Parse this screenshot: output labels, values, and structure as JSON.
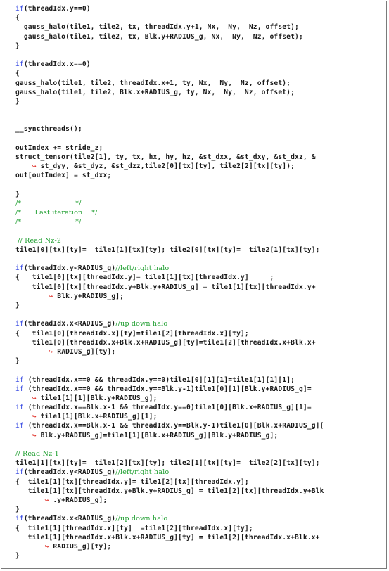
{
  "listing": {
    "lines": [
      [
        {
          "t": "kw",
          "v": "if"
        },
        {
          "t": "tx",
          "v": "(threadIdx.y==0)"
        }
      ],
      [
        {
          "t": "tx",
          "v": "{"
        }
      ],
      [
        {
          "t": "tx",
          "v": "  gauss_halo(tile1, tile2, tx, threadIdx.y+1, Nx,  Ny,  Nz, offset);"
        }
      ],
      [
        {
          "t": "tx",
          "v": "  gauss_halo(tile1, tile2, tx, Blk.y+RADIUS_g, Nx,  Ny,  Nz, offset);"
        }
      ],
      [
        {
          "t": "tx",
          "v": "}"
        }
      ],
      [],
      [
        {
          "t": "kw",
          "v": "if"
        },
        {
          "t": "tx",
          "v": "(threadIdx.x==0)"
        }
      ],
      [
        {
          "t": "tx",
          "v": "{"
        }
      ],
      [
        {
          "t": "tx",
          "v": "gauss_halo(tile1, tile2, threadIdx.x+1, ty, Nx,  Ny,  Nz, offset);"
        }
      ],
      [
        {
          "t": "tx",
          "v": "gauss_halo(tile1, tile2, Blk.x+RADIUS_g, ty, Nx,  Ny,  Nz, offset);"
        }
      ],
      [
        {
          "t": "tx",
          "v": "}"
        }
      ],
      [],
      [],
      [
        {
          "t": "tx",
          "v": "__syncthreads();"
        }
      ],
      [],
      [
        {
          "t": "tx",
          "v": "outIndex += stride_z;"
        }
      ],
      [
        {
          "t": "tx",
          "v": "struct_tensor(tile2[1], ty, tx, hx, hy, hz, &st_dxx, &st_dxy, &st_dxz, &"
        }
      ],
      [
        {
          "t": "tx",
          "v": "    "
        },
        {
          "t": "arrow",
          "v": "↪"
        },
        {
          "t": "tx",
          "v": " st_dyy, &st_dyz, &st_dzz,tile2[0][tx][ty], tile2[2][tx][ty]);"
        }
      ],
      [
        {
          "t": "tx",
          "v": "out[outIndex] = st_dxx;"
        }
      ],
      [],
      [
        {
          "t": "tx",
          "v": "}"
        }
      ],
      [
        {
          "t": "cm",
          "v": "/*                        */"
        }
      ],
      [
        {
          "t": "cm",
          "v": "/*      Last iteration    */"
        }
      ],
      [
        {
          "t": "cm",
          "v": "/*                        */"
        }
      ],
      [],
      [
        {
          "t": "cm",
          "v": " // Read Nz-2"
        }
      ],
      [
        {
          "t": "tx",
          "v": "tile1[0][tx][ty]=  tile1[1][tx][ty]; tile2[0][tx][ty]=  tile2[1][tx][ty];"
        }
      ],
      [],
      [
        {
          "t": "kw",
          "v": "if"
        },
        {
          "t": "tx",
          "v": "(threadIdx.y<RADIUS_g)"
        },
        {
          "t": "cm",
          "v": "//left/right halo"
        }
      ],
      [
        {
          "t": "tx",
          "v": "{   tile1[0][tx][threadIdx.y]= tile1[1][tx][threadIdx.y]     ;"
        }
      ],
      [
        {
          "t": "tx",
          "v": "    tile1[0][tx][threadIdx.y+Blk.y+RADIUS_g] = tile1[1][tx][threadIdx.y+"
        }
      ],
      [
        {
          "t": "tx",
          "v": "        "
        },
        {
          "t": "arrow",
          "v": "↪"
        },
        {
          "t": "tx",
          "v": " Blk.y+RADIUS_g];"
        }
      ],
      [
        {
          "t": "tx",
          "v": "}"
        }
      ],
      [],
      [
        {
          "t": "kw",
          "v": "if"
        },
        {
          "t": "tx",
          "v": "(threadIdx.x<RADIUS_g)"
        },
        {
          "t": "cm",
          "v": "//up down halo"
        }
      ],
      [
        {
          "t": "tx",
          "v": "{   tile1[0][threadIdx.x][ty]=tile1[2][threadIdx.x][ty];"
        }
      ],
      [
        {
          "t": "tx",
          "v": "    tile1[0][threadIdx.x+Blk.x+RADIUS_g][ty]=tile1[2][threadIdx.x+Blk.x+"
        }
      ],
      [
        {
          "t": "tx",
          "v": "        "
        },
        {
          "t": "arrow",
          "v": "↪"
        },
        {
          "t": "tx",
          "v": " RADIUS_g][ty];"
        }
      ],
      [
        {
          "t": "tx",
          "v": "}"
        }
      ],
      [],
      [
        {
          "t": "kw",
          "v": "if"
        },
        {
          "t": "tx",
          "v": " (threadIdx.x==0 && threadIdx.y==0)tile1[0][1][1]=tile1[1][1][1];"
        }
      ],
      [
        {
          "t": "kw",
          "v": "if"
        },
        {
          "t": "tx",
          "v": " (threadIdx.x==0 && threadIdx.y==Blk.y-1)tile1[0][1][Blk.y+RADIUS_g]="
        }
      ],
      [
        {
          "t": "tx",
          "v": "    "
        },
        {
          "t": "arrow",
          "v": "↪"
        },
        {
          "t": "tx",
          "v": " tile1[1][1][Blk.y+RADIUS_g];"
        }
      ],
      [
        {
          "t": "kw",
          "v": "if"
        },
        {
          "t": "tx",
          "v": " (threadIdx.x==Blk.x-1 && threadIdx.y==0)tile1[0][Blk.x+RADIUS_g][1]="
        }
      ],
      [
        {
          "t": "tx",
          "v": "    "
        },
        {
          "t": "arrow",
          "v": "↪"
        },
        {
          "t": "tx",
          "v": " tile1[1][Blk.x+RADIUS_g][1];"
        }
      ],
      [
        {
          "t": "kw",
          "v": "if"
        },
        {
          "t": "tx",
          "v": " (threadIdx.x==Blk.x-1 && threadIdx.y==Blk.y-1)tile1[0][Blk.x+RADIUS_g]["
        }
      ],
      [
        {
          "t": "tx",
          "v": "    "
        },
        {
          "t": "arrow",
          "v": "↪"
        },
        {
          "t": "tx",
          "v": " Blk.y+RADIUS_g]=tile1[1][Blk.x+RADIUS_g][Blk.y+RADIUS_g];"
        }
      ],
      [],
      [
        {
          "t": "cm",
          "v": "// Read Nz-1"
        }
      ],
      [
        {
          "t": "tx",
          "v": "tile1[1][tx][ty]=  tile1[2][tx][ty]; tile2[1][tx][ty]=  tile2[2][tx][ty];"
        }
      ],
      [
        {
          "t": "kw",
          "v": "if"
        },
        {
          "t": "tx",
          "v": "(threadIdx.y<RADIUS_g)"
        },
        {
          "t": "cm",
          "v": "//left/right halo"
        }
      ],
      [
        {
          "t": "tx",
          "v": "{  tile1[1][tx][threadIdx.y]= tile1[2][tx][threadIdx.y];"
        }
      ],
      [
        {
          "t": "tx",
          "v": "   tile1[1][tx][threadIdx.y+Blk.y+RADIUS_g] = tile1[2][tx][threadIdx.y+Blk"
        }
      ],
      [
        {
          "t": "tx",
          "v": "       "
        },
        {
          "t": "arrow",
          "v": "↪"
        },
        {
          "t": "tx",
          "v": " .y+RADIUS_g];"
        }
      ],
      [
        {
          "t": "tx",
          "v": "}"
        }
      ],
      [
        {
          "t": "kw",
          "v": "if"
        },
        {
          "t": "tx",
          "v": "(threadIdx.x<RADIUS_g)"
        },
        {
          "t": "cm",
          "v": "//up down halo"
        }
      ],
      [
        {
          "t": "tx",
          "v": "{  tile1[1][threadIdx.x][ty]  =tile1[2][threadIdx.x][ty];"
        }
      ],
      [
        {
          "t": "tx",
          "v": "   tile1[1][threadIdx.x+Blk.x+RADIUS_g][ty] = tile1[2][threadIdx.x+Blk.x+"
        }
      ],
      [
        {
          "t": "tx",
          "v": "       "
        },
        {
          "t": "arrow",
          "v": "↪"
        },
        {
          "t": "tx",
          "v": " RADIUS_g][ty];"
        }
      ],
      [
        {
          "t": "tx",
          "v": "}"
        }
      ]
    ]
  },
  "colors": {
    "keyword": "#2b3fe0",
    "comment": "#22a033",
    "continuation_arrow": "#e0342c",
    "text": "#1a1a1a",
    "frame_border": "#7a7a7a"
  }
}
